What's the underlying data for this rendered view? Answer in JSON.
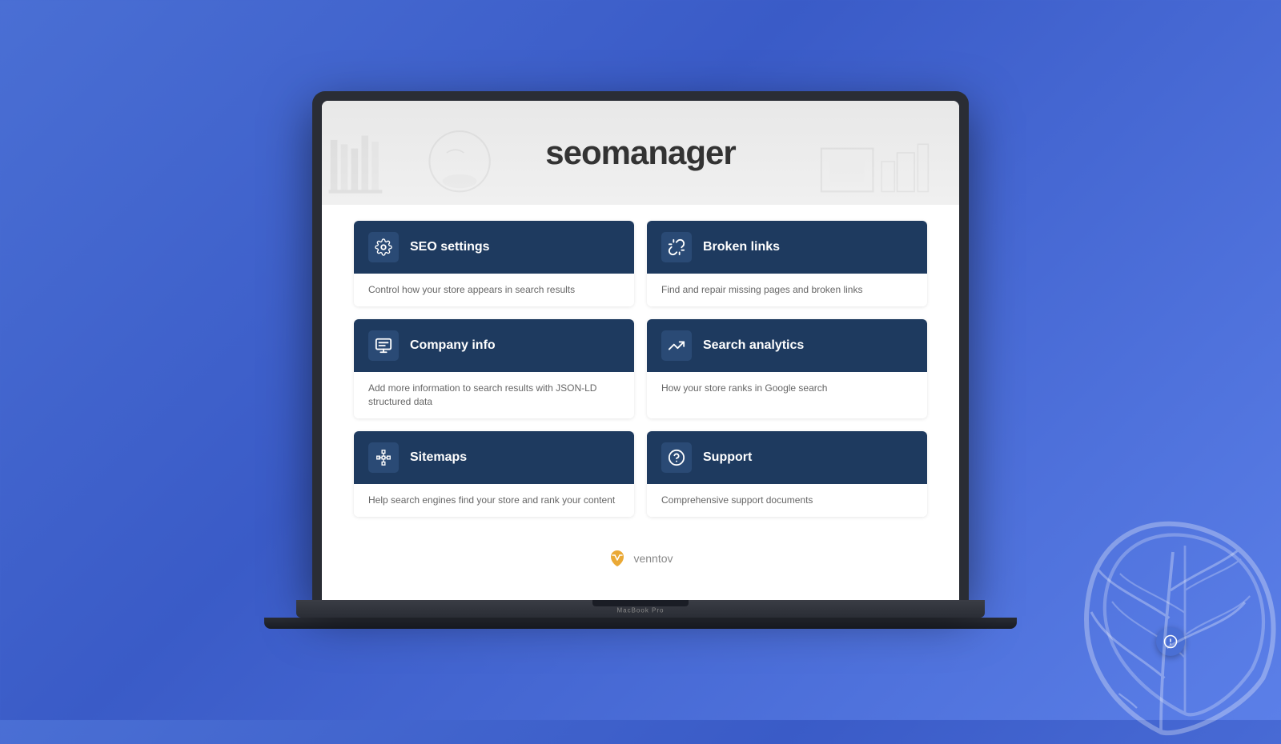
{
  "background": {
    "gradient_start": "#4a6fd4",
    "gradient_end": "#5b7fe8"
  },
  "laptop": {
    "model_label": "MacBook Pro"
  },
  "app": {
    "logo_light": "seo",
    "logo_bold": "manager",
    "full_title": "seomanager"
  },
  "cards": [
    {
      "id": "seo-settings",
      "title": "SEO settings",
      "description": "Control how your store appears in search results",
      "icon": "gear"
    },
    {
      "id": "broken-links",
      "title": "Broken links",
      "description": "Find and repair missing pages and broken links",
      "icon": "broken-link"
    },
    {
      "id": "company-info",
      "title": "Company info",
      "description": "Add more information to search results with JSON-LD structured data",
      "icon": "company"
    },
    {
      "id": "search-analytics",
      "title": "Search analytics",
      "description": "How your store ranks in Google search",
      "icon": "analytics"
    },
    {
      "id": "sitemaps",
      "title": "Sitemaps",
      "description": "Help search engines find your store and rank your content",
      "icon": "sitemap"
    },
    {
      "id": "support",
      "title": "Support",
      "description": "Comprehensive support documents",
      "icon": "support"
    }
  ],
  "branding": {
    "venntov_text": "venntov"
  },
  "float_button": {
    "icon": "chat-icon"
  }
}
